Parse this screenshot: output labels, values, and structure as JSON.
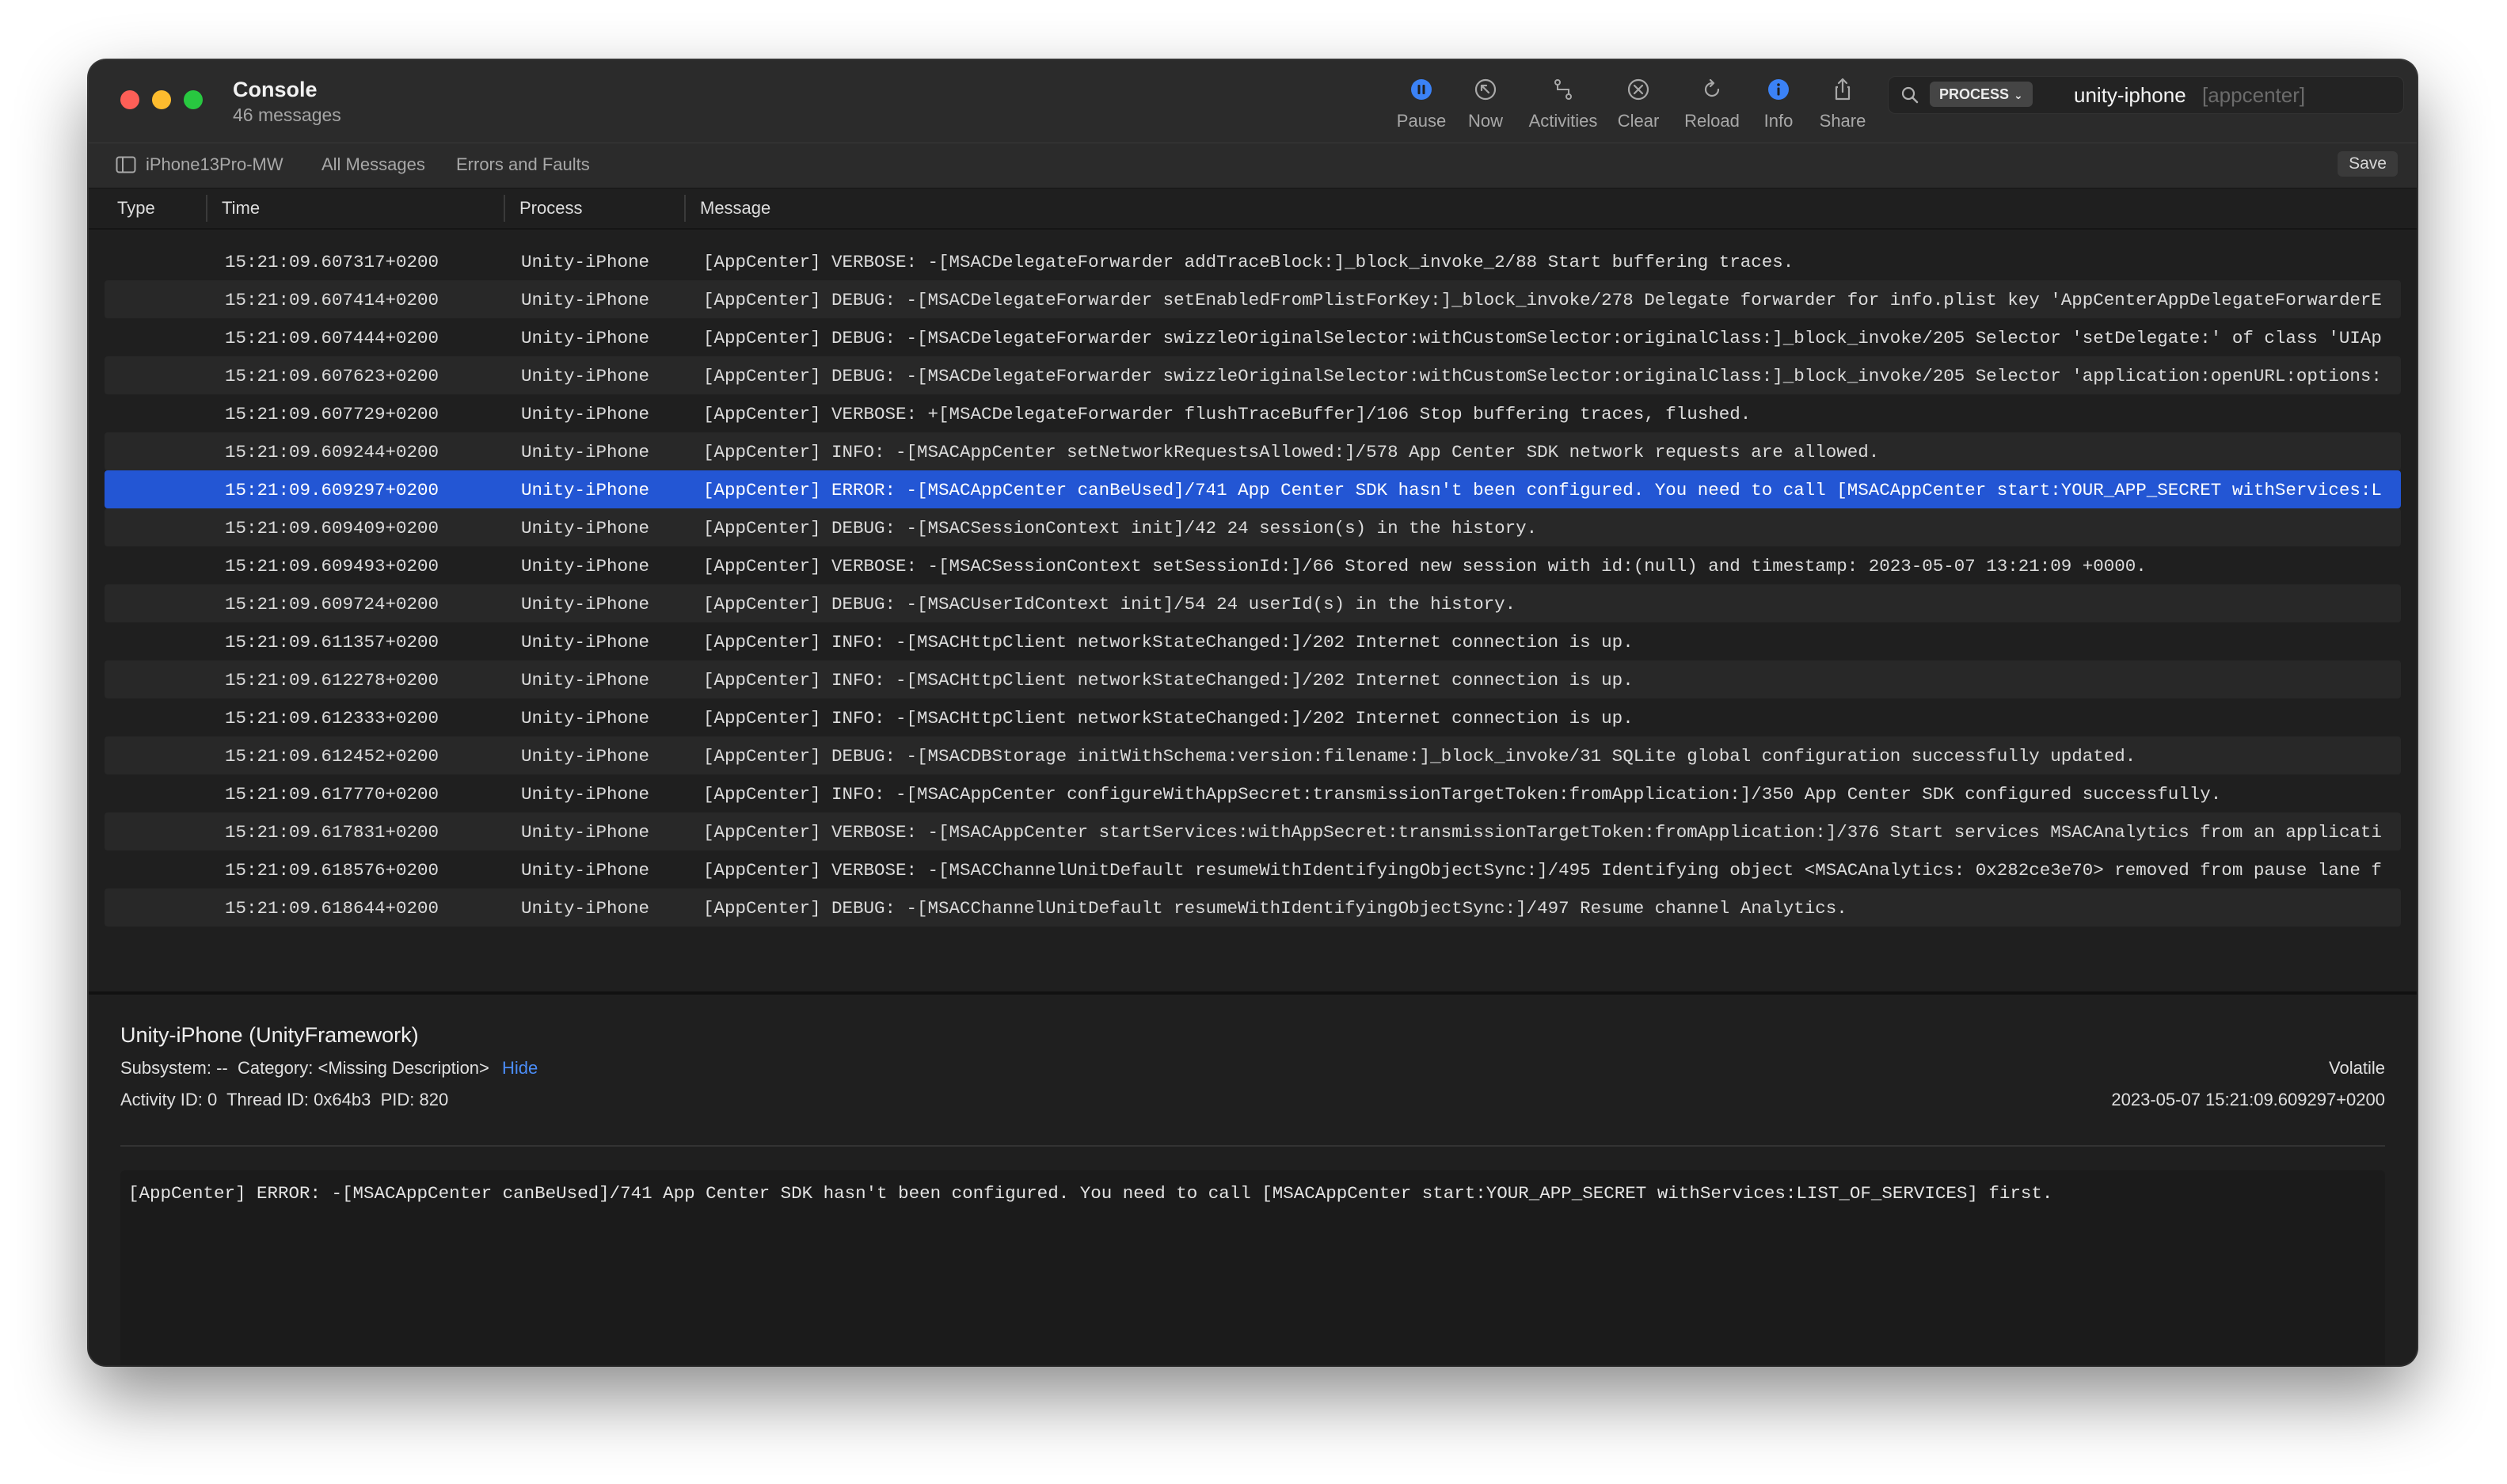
{
  "window": {
    "title": "Console",
    "subtitle": "46 messages"
  },
  "toolbar": {
    "pause": "Pause",
    "now": "Now",
    "activities": "Activities",
    "clear": "Clear",
    "reload": "Reload",
    "info": "Info",
    "share": "Share"
  },
  "search": {
    "token_label": "PROCESS",
    "token_value": "unity-iphone",
    "placeholder": "[appcenter]"
  },
  "filterbar": {
    "device": "iPhone13Pro-MW",
    "all_messages": "All Messages",
    "errors_and_faults": "Errors and Faults",
    "save": "Save"
  },
  "columns": {
    "type": "Type",
    "time": "Time",
    "process": "Process",
    "message": "Message"
  },
  "log_rows": [
    {
      "time": "15:21:09.607317+0200",
      "process": "Unity-iPhone",
      "message": "[AppCenter] VERBOSE: -[MSACDelegateForwarder addTraceBlock:]_block_invoke_2/88 Start buffering traces."
    },
    {
      "time": "15:21:09.607414+0200",
      "process": "Unity-iPhone",
      "message": "[AppCenter] DEBUG: -[MSACDelegateForwarder setEnabledFromPlistForKey:]_block_invoke/278 Delegate forwarder for info.plist key 'AppCenterAppDelegateForwarderE"
    },
    {
      "time": "15:21:09.607444+0200",
      "process": "Unity-iPhone",
      "message": "[AppCenter] DEBUG: -[MSACDelegateForwarder swizzleOriginalSelector:withCustomSelector:originalClass:]_block_invoke/205 Selector 'setDelegate:' of class 'UIAp"
    },
    {
      "time": "15:21:09.607623+0200",
      "process": "Unity-iPhone",
      "message": "[AppCenter] DEBUG: -[MSACDelegateForwarder swizzleOriginalSelector:withCustomSelector:originalClass:]_block_invoke/205 Selector 'application:openURL:options:"
    },
    {
      "time": "15:21:09.607729+0200",
      "process": "Unity-iPhone",
      "message": "[AppCenter] VERBOSE: +[MSACDelegateForwarder flushTraceBuffer]/106 Stop buffering traces, flushed."
    },
    {
      "time": "15:21:09.609244+0200",
      "process": "Unity-iPhone",
      "message": "[AppCenter] INFO: -[MSACAppCenter setNetworkRequestsAllowed:]/578 App Center SDK network requests are allowed."
    },
    {
      "time": "15:21:09.609297+0200",
      "process": "Unity-iPhone",
      "message": "[AppCenter] ERROR: -[MSACAppCenter canBeUsed]/741 App Center SDK hasn't been configured. You need to call [MSACAppCenter start:YOUR_APP_SECRET withServices:L"
    },
    {
      "time": "15:21:09.609409+0200",
      "process": "Unity-iPhone",
      "message": "[AppCenter] DEBUG: -[MSACSessionContext init]/42 24 session(s) in the history."
    },
    {
      "time": "15:21:09.609493+0200",
      "process": "Unity-iPhone",
      "message": "[AppCenter] VERBOSE: -[MSACSessionContext setSessionId:]/66 Stored new session with id:(null) and timestamp: 2023-05-07 13:21:09 +0000."
    },
    {
      "time": "15:21:09.609724+0200",
      "process": "Unity-iPhone",
      "message": "[AppCenter] DEBUG: -[MSACUserIdContext init]/54 24 userId(s) in the history."
    },
    {
      "time": "15:21:09.611357+0200",
      "process": "Unity-iPhone",
      "message": "[AppCenter] INFO: -[MSACHttpClient networkStateChanged:]/202 Internet connection is up."
    },
    {
      "time": "15:21:09.612278+0200",
      "process": "Unity-iPhone",
      "message": "[AppCenter] INFO: -[MSACHttpClient networkStateChanged:]/202 Internet connection is up."
    },
    {
      "time": "15:21:09.612333+0200",
      "process": "Unity-iPhone",
      "message": "[AppCenter] INFO: -[MSACHttpClient networkStateChanged:]/202 Internet connection is up."
    },
    {
      "time": "15:21:09.612452+0200",
      "process": "Unity-iPhone",
      "message": "[AppCenter] DEBUG: -[MSACDBStorage initWithSchema:version:filename:]_block_invoke/31 SQLite global configuration successfully updated."
    },
    {
      "time": "15:21:09.617770+0200",
      "process": "Unity-iPhone",
      "message": "[AppCenter] INFO: -[MSACAppCenter configureWithAppSecret:transmissionTargetToken:fromApplication:]/350 App Center SDK configured successfully."
    },
    {
      "time": "15:21:09.617831+0200",
      "process": "Unity-iPhone",
      "message": "[AppCenter] VERBOSE: -[MSACAppCenter startServices:withAppSecret:transmissionTargetToken:fromApplication:]/376 Start services MSACAnalytics from an applicati"
    },
    {
      "time": "15:21:09.618576+0200",
      "process": "Unity-iPhone",
      "message": "[AppCenter] VERBOSE: -[MSACChannelUnitDefault resumeWithIdentifyingObjectSync:]/495 Identifying object <MSACAnalytics: 0x282ce3e70> removed from pause lane f"
    },
    {
      "time": "15:21:09.618644+0200",
      "process": "Unity-iPhone",
      "message": "[AppCenter] DEBUG: -[MSACChannelUnitDefault resumeWithIdentifyingObjectSync:]/497 Resume channel Analytics."
    }
  ],
  "selected_row_index": 6,
  "detail": {
    "title": "Unity-iPhone (UnityFramework)",
    "subsystem_label": "Subsystem:",
    "subsystem_value": "--",
    "category_label": "Category:",
    "category_value": "<Missing Description>",
    "hide": "Hide",
    "activity_label": "Activity ID:",
    "activity_value": "0",
    "thread_label": "Thread ID:",
    "thread_value": "0x64b3",
    "pid_label": "PID:",
    "pid_value": "820",
    "volatile": "Volatile",
    "timestamp": "2023-05-07 15:21:09.609297+0200",
    "message": "[AppCenter] ERROR: -[MSACAppCenter canBeUsed]/741 App Center SDK hasn't been configured. You need to call [MSACAppCenter start:YOUR_APP_SECRET withServices:LIST_OF_SERVICES] first."
  },
  "colors": {
    "window_bg": "#1f1f1f",
    "selection": "#2356d4",
    "accent_blue": "#3b82f6",
    "link_blue": "#4b8df7"
  },
  "icons": {
    "pause": "pause-circle-icon",
    "now": "now-arrow-icon",
    "activities": "activities-icon",
    "clear": "clear-x-icon",
    "reload": "reload-icon",
    "info": "info-icon",
    "share": "share-icon",
    "search": "search-icon",
    "sidebar": "sidebar-toggle-icon"
  }
}
